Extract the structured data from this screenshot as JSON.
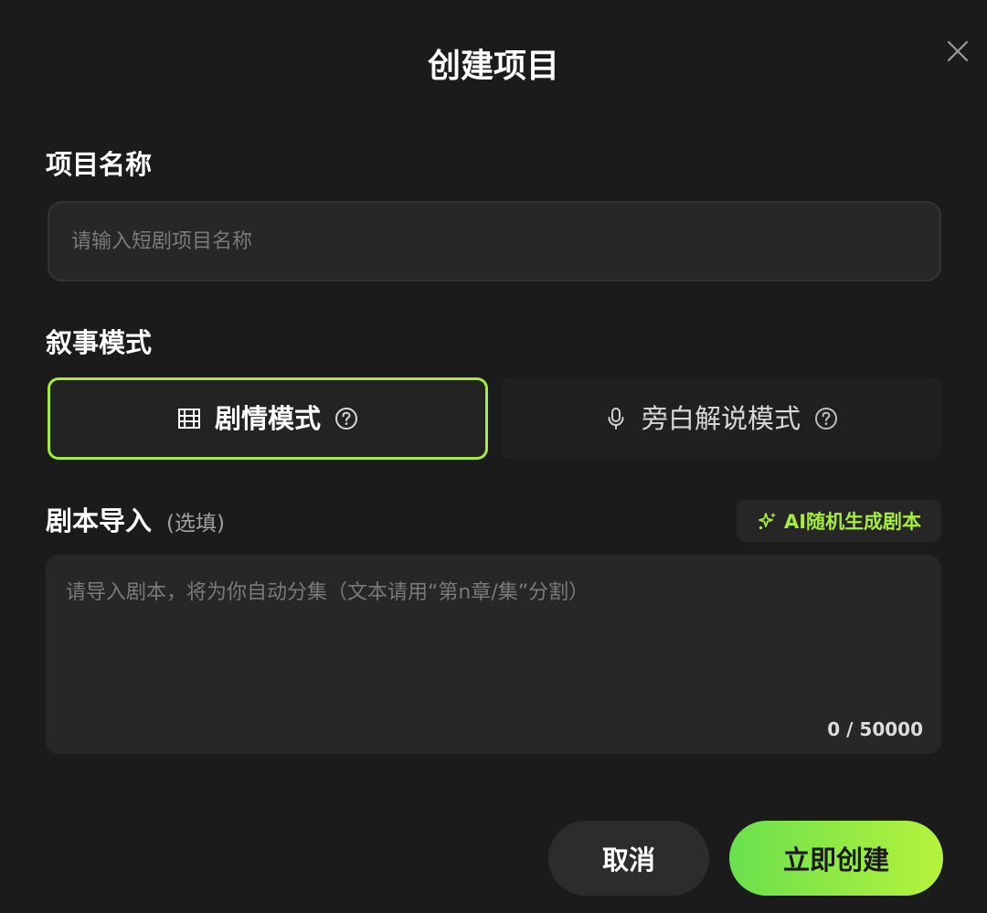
{
  "dialog": {
    "title": "创建项目",
    "close_icon": "close-icon"
  },
  "project_name": {
    "label": "项目名称",
    "value": "",
    "placeholder": "请输入短剧项目名称"
  },
  "narrative_mode": {
    "label": "叙事模式",
    "selected": "剧情模式",
    "options": [
      {
        "label": "剧情模式",
        "icon": "film-icon",
        "active": true
      },
      {
        "label": "旁白解说模式",
        "icon": "microphone-icon",
        "active": false
      }
    ]
  },
  "script_import": {
    "label": "剧本导入",
    "optional": "(选填)",
    "ai_button": "AI随机生成剧本",
    "value": "",
    "placeholder": "请导入剧本，将为你自动分集（文本请用“第n章/集”分割）",
    "counter": "0 / 50000"
  },
  "actions": {
    "cancel": "取消",
    "create": "立即创建"
  },
  "colors": {
    "accent": "#a6ec3e",
    "background": "#1b1b1b",
    "field": "#272727"
  }
}
